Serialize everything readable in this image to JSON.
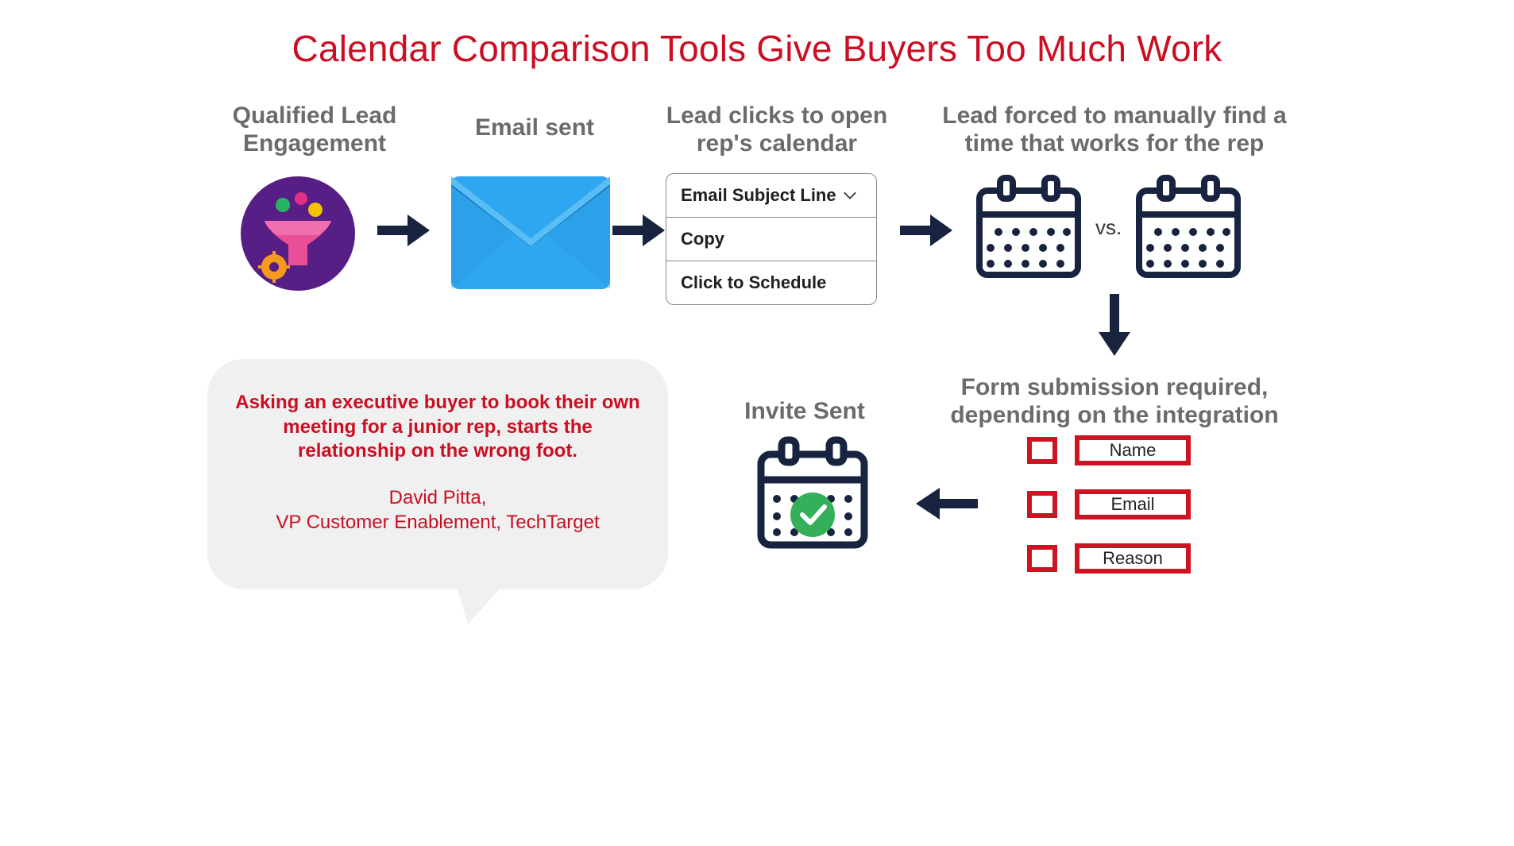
{
  "title": "Calendar Comparison Tools Give Buyers Too Much Work",
  "steps": {
    "lead_engagement": "Qualified Lead Engagement",
    "email_sent": "Email sent",
    "lead_clicks": "Lead clicks to open rep's calendar",
    "lead_forced": "Lead forced to manually find a time that works for the rep",
    "form_required": "Form submission required, depending on the integration",
    "invite_sent": "Invite Sent"
  },
  "email_card": {
    "subject": "Email Subject Line",
    "copy": "Copy",
    "schedule": "Click to Schedule"
  },
  "vs_label": "vs.",
  "form_fields": [
    "Name",
    "Email",
    "Reason"
  ],
  "quote": {
    "text": "Asking an executive buyer to book their own meeting for a junior rep, starts the relationship on the wrong foot.",
    "author": "David Pitta,",
    "role": "VP Customer Enablement, TechTarget"
  },
  "colors": {
    "accent": "#cc0e23",
    "navy": "#17233f",
    "blue": "#26a3ee",
    "gray": "#6b6b6b"
  }
}
